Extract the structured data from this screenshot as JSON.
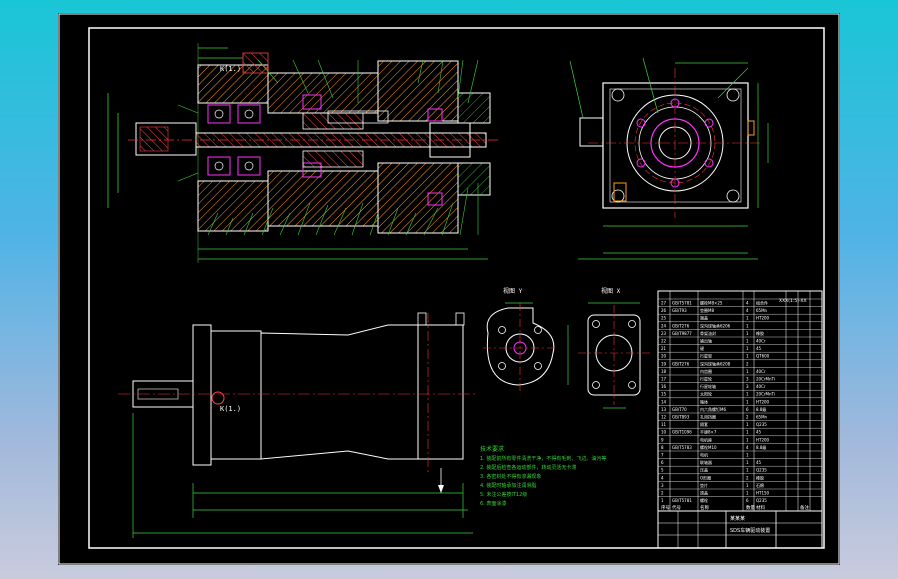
{
  "drawing": {
    "view_labels": {
      "top_section_detail": "K(1.)",
      "bottom_detail": "K(1.)",
      "left_detail_title": "视图 Y",
      "right_detail_title": "视图 X"
    },
    "notes_title": "技术要求",
    "notes_lines": [
      "1. 装配前所有零件清洗干净，不得有毛刺、飞边、油污等",
      "2. 装配后检查各运动部件，转动灵活无卡滞",
      "3. 各密封处不得有渗漏现象",
      "4. 装配时轴承加注润滑脂",
      "5. 未注公差按IT12级",
      "6. 表面涂漆"
    ],
    "title_block": {
      "designer": "某某某",
      "drawing_title": "SDS车辆驱动装置",
      "drawing_code": "XXX(1:5)-XX"
    },
    "bom_rows": [
      {
        "no": "27",
        "code": "GB/T5781",
        "name": "螺栓M8×25",
        "qty": "4",
        "mat": "组合件",
        "note": ""
      },
      {
        "no": "26",
        "code": "GB/T93",
        "name": "垫圈M8",
        "qty": "4",
        "mat": "65Mn",
        "note": ""
      },
      {
        "no": "25",
        "code": "",
        "name": "端盖",
        "qty": "1",
        "mat": "HT200",
        "note": ""
      },
      {
        "no": "24",
        "code": "GB/T276",
        "name": "深沟球轴承6206",
        "qty": "1",
        "mat": "",
        "note": ""
      },
      {
        "no": "23",
        "code": "GB/T9877",
        "name": "骨架油封",
        "qty": "1",
        "mat": "橡胶",
        "note": ""
      },
      {
        "no": "22",
        "code": "",
        "name": "输出轴",
        "qty": "1",
        "mat": "40Cr",
        "note": ""
      },
      {
        "no": "21",
        "code": "",
        "name": "键",
        "qty": "1",
        "mat": "45",
        "note": ""
      },
      {
        "no": "20",
        "code": "",
        "name": "行星架",
        "qty": "1",
        "mat": "QT600",
        "note": ""
      },
      {
        "no": "19",
        "code": "GB/T276",
        "name": "深沟球轴承6208",
        "qty": "2",
        "mat": "",
        "note": ""
      },
      {
        "no": "18",
        "code": "",
        "name": "内齿圈",
        "qty": "1",
        "mat": "40Cr",
        "note": ""
      },
      {
        "no": "17",
        "code": "",
        "name": "行星轮",
        "qty": "3",
        "mat": "20CrMnTi",
        "note": ""
      },
      {
        "no": "16",
        "code": "",
        "name": "行星轮轴",
        "qty": "3",
        "mat": "40Cr",
        "note": ""
      },
      {
        "no": "15",
        "code": "",
        "name": "太阳轮",
        "qty": "1",
        "mat": "20CrMnTi",
        "note": ""
      },
      {
        "no": "14",
        "code": "",
        "name": "箱体",
        "qty": "1",
        "mat": "HT200",
        "note": ""
      },
      {
        "no": "13",
        "code": "GB/T70",
        "name": "内六角螺钉M6",
        "qty": "6",
        "mat": "8.8级",
        "note": ""
      },
      {
        "no": "12",
        "code": "GB/T893",
        "name": "孔用挡圈",
        "qty": "2",
        "mat": "65Mn",
        "note": ""
      },
      {
        "no": "11",
        "code": "",
        "name": "隔套",
        "qty": "1",
        "mat": "Q235",
        "note": ""
      },
      {
        "no": "10",
        "code": "GB/T1096",
        "name": "平键8×7",
        "qty": "1",
        "mat": "45",
        "note": ""
      },
      {
        "no": "9",
        "code": "",
        "name": "电机座",
        "qty": "1",
        "mat": "HT200",
        "note": ""
      },
      {
        "no": "8",
        "code": "GB/T5783",
        "name": "螺栓M10",
        "qty": "4",
        "mat": "8.8级",
        "note": ""
      },
      {
        "no": "7",
        "code": "",
        "name": "电机",
        "qty": "1",
        "mat": "",
        "note": ""
      },
      {
        "no": "6",
        "code": "",
        "name": "联轴器",
        "qty": "1",
        "mat": "45",
        "note": ""
      },
      {
        "no": "5",
        "code": "",
        "name": "压盖",
        "qty": "1",
        "mat": "Q235",
        "note": ""
      },
      {
        "no": "4",
        "code": "",
        "name": "O形圈",
        "qty": "2",
        "mat": "橡胶",
        "note": ""
      },
      {
        "no": "3",
        "code": "",
        "name": "垫片",
        "qty": "1",
        "mat": "石棉",
        "note": ""
      },
      {
        "no": "2",
        "code": "",
        "name": "透盖",
        "qty": "1",
        "mat": "HT150",
        "note": ""
      },
      {
        "no": "1",
        "code": "GB/T5781",
        "name": "螺栓",
        "qty": "6",
        "mat": "Q235",
        "note": ""
      }
    ],
    "bom_header": {
      "no": "序号",
      "code": "代号",
      "name": "名称",
      "qty": "数量",
      "mat": "材料",
      "note": "备注"
    },
    "colors": {
      "frame": "#ffffff",
      "outline": "#ffffff",
      "section_hatch": "#ff9a1a",
      "hatch_red": "#ff3030",
      "centerline": "#ff3030",
      "dimension": "#39d339",
      "parts_magenta": "#ff30ff",
      "notes_green": "#39d339"
    }
  }
}
